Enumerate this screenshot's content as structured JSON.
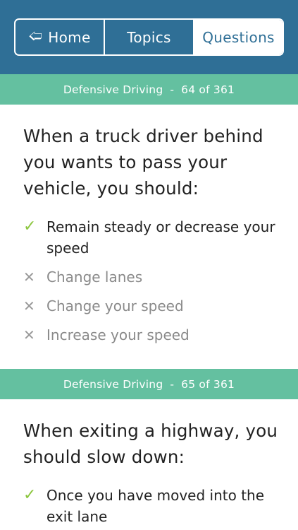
{
  "nav": {
    "home_label": "Home",
    "topics_label": "Topics",
    "questions_label": "Questions"
  },
  "questions": [
    {
      "category": "Defensive Driving",
      "separator": "-",
      "progress": "64 of 361",
      "question": "When a truck driver behind you wants to pass your vehicle, you should:",
      "answers": [
        {
          "text": "Remain steady or decrease your speed",
          "correct": true
        },
        {
          "text": "Change lanes",
          "correct": false
        },
        {
          "text": "Change your speed",
          "correct": false
        },
        {
          "text": "Increase your speed",
          "correct": false
        }
      ]
    },
    {
      "category": "Defensive Driving",
      "separator": "-",
      "progress": "65 of 361",
      "question": "When exiting a highway, you should slow down:",
      "answers": [
        {
          "text": "Once you have moved into the exit lane",
          "correct": true
        }
      ]
    }
  ],
  "icons": {
    "correct": "check-icon",
    "wrong": "x-icon",
    "home": "arrow-left-icon"
  },
  "colors": {
    "header": "#2f6f96",
    "band": "#64c0a0",
    "check": "#8cc63f"
  }
}
